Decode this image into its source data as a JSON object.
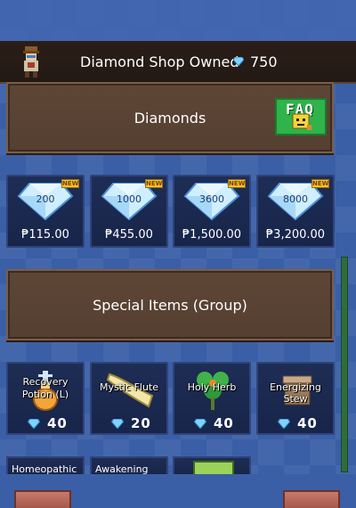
{
  "header": {
    "title": "Diamond Shop Owned",
    "diamonds_owned": "750"
  },
  "diamonds_section": {
    "title": "Diamonds",
    "faq_label": "FAQ"
  },
  "diamond_packs": [
    {
      "amount": "200",
      "price": "₱115.00",
      "badge": "NEW"
    },
    {
      "amount": "1000",
      "price": "₱455.00",
      "badge": "NEW"
    },
    {
      "amount": "3600",
      "price": "₱1,500.00",
      "badge": "NEW"
    },
    {
      "amount": "8000",
      "price": "₱3,200.00",
      "badge": "NEW"
    }
  ],
  "special_section": {
    "title": "Special Items (Group)"
  },
  "special_items": [
    {
      "name": "Recovery Potion (L)",
      "cost": "40",
      "icon": "potion-icon"
    },
    {
      "name": "Mystic Flute",
      "cost": "20",
      "icon": "horn-icon"
    },
    {
      "name": "Holy Herb",
      "cost": "40",
      "icon": "herb-icon"
    },
    {
      "name": "Energizing Stew",
      "cost": "40",
      "icon": "pot-icon"
    }
  ],
  "special_items_row2": [
    {
      "name": "Homeopathic"
    },
    {
      "name": "Awakening"
    },
    {
      "name": ""
    }
  ],
  "colors": {
    "background": "#3a5fa6",
    "panel_brown": "#5e4636",
    "card_navy": "#1e2d55",
    "faq_green": "#2fb34a",
    "badge_yellow": "#f3c42b"
  }
}
